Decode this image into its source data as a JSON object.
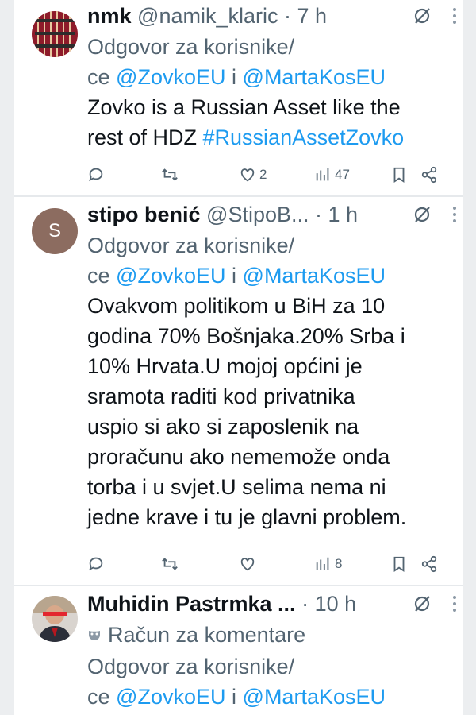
{
  "tweets": [
    {
      "name": "nmk",
      "handle": "@namik_klaric",
      "sep": "·",
      "time": "7 h",
      "reply_prefix_1": "Odgovor za korisnike/",
      "reply_prefix_2": "ce",
      "mention_1": "@ZovkoEU",
      "conj": "i",
      "mention_2": "@MartaKosEU",
      "text_lines": [
        "Zovko is a Russian Asset like the",
        "rest of HDZ "
      ],
      "hashtag": "#RussianAssetZovko",
      "likes": "2",
      "views": "47"
    },
    {
      "name": "stipo benić",
      "handle": "@StipoB...",
      "sep": "·",
      "time": "1 h",
      "avatar_letter": "S",
      "reply_prefix_1": "Odgovor za korisnike/",
      "reply_prefix_2": "ce",
      "mention_1": "@ZovkoEU",
      "conj": "i",
      "mention_2": "@MartaKosEU",
      "text_lines": [
        "Ovakvom politikom u BiH za 10",
        "godina 70%  Bošnjaka.20% Srba i",
        "10% Hrvata.U mojoj općini je",
        "sramota raditi kod privatnika",
        "uspio si ako si zaposlenik na",
        "proračunu ako nememože onda",
        "torba i u svjet.U selima nema ni",
        "jedne krave i tu je glavni problem."
      ],
      "likes": "",
      "views": "8"
    },
    {
      "name": "Muhidin Pastrmka ...",
      "sep": "·",
      "time": "10 h",
      "account_label": "Račun za komentare",
      "reply_prefix_1": "Odgovor za korisnike/",
      "reply_prefix_2": "ce",
      "mention_1": "@ZovkoEU",
      "conj": "i",
      "mention_2": "@MartaKosEU"
    }
  ],
  "colors": {
    "link": "#1d9bf0",
    "muted": "#536471",
    "text": "#0f1419"
  },
  "icons": [
    "reply-icon",
    "retweet-icon",
    "like-icon",
    "views-icon",
    "bookmark-icon",
    "share-icon",
    "grok-icon",
    "more-icon"
  ]
}
